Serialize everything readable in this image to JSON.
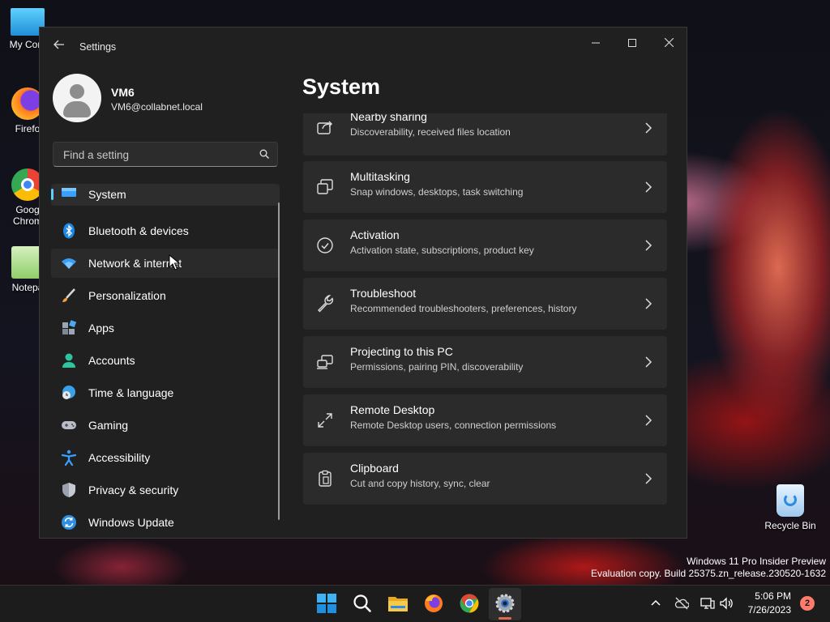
{
  "desktop": {
    "icons": [
      {
        "label": "My Com"
      },
      {
        "label": "Firefo"
      },
      {
        "label": "Goog\nChrom"
      },
      {
        "label": "Notepa"
      },
      {
        "label": "Recycle Bin"
      }
    ],
    "watermark": {
      "line1": "Windows 11 Pro Insider Preview",
      "line2": "Evaluation copy. Build 25375.zn_release.230520-1632"
    }
  },
  "window": {
    "title": "Settings",
    "profile": {
      "name": "VM6",
      "email": "VM6@collabnet.local"
    },
    "search": {
      "placeholder": "Find a setting",
      "value": ""
    },
    "nav": [
      {
        "label": "System",
        "icon": "monitor-icon",
        "selected": true
      },
      {
        "label": "Bluetooth & devices",
        "icon": "bluetooth-icon"
      },
      {
        "label": "Network & internet",
        "icon": "wifi-icon",
        "hover": true
      },
      {
        "label": "Personalization",
        "icon": "brush-icon"
      },
      {
        "label": "Apps",
        "icon": "apps-icon"
      },
      {
        "label": "Accounts",
        "icon": "person-icon"
      },
      {
        "label": "Time & language",
        "icon": "globe-clock-icon"
      },
      {
        "label": "Gaming",
        "icon": "gamepad-icon"
      },
      {
        "label": "Accessibility",
        "icon": "accessibility-icon"
      },
      {
        "label": "Privacy & security",
        "icon": "shield-icon"
      },
      {
        "label": "Windows Update",
        "icon": "update-icon"
      }
    ],
    "page_title": "System",
    "cards": [
      {
        "title": "Nearby sharing",
        "subtitle": "Discoverability, received files location",
        "icon": "share-icon"
      },
      {
        "title": "Multitasking",
        "subtitle": "Snap windows, desktops, task switching",
        "icon": "multitask-icon"
      },
      {
        "title": "Activation",
        "subtitle": "Activation state, subscriptions, product key",
        "icon": "check-circle-icon"
      },
      {
        "title": "Troubleshoot",
        "subtitle": "Recommended troubleshooters, preferences, history",
        "icon": "wrench-icon"
      },
      {
        "title": "Projecting to this PC",
        "subtitle": "Permissions, pairing PIN, discoverability",
        "icon": "project-icon"
      },
      {
        "title": "Remote Desktop",
        "subtitle": "Remote Desktop users, connection permissions",
        "icon": "remote-desktop-icon"
      },
      {
        "title": "Clipboard",
        "subtitle": "Cut and copy history, sync, clear",
        "icon": "clipboard-icon"
      }
    ]
  },
  "taskbar": {
    "apps": [
      "start-icon",
      "search-icon",
      "file-explorer-icon",
      "firefox-icon",
      "chrome-icon",
      "settings-icon"
    ],
    "active": "settings-icon",
    "clock": {
      "time": "5:06 PM",
      "date": "7/26/2023"
    },
    "notifications": "2"
  },
  "colors": {
    "accent": "#60cdff",
    "window_bg": "#202020",
    "card_bg": "#2b2b2b",
    "taskbar_indicator": "#e06a50"
  }
}
